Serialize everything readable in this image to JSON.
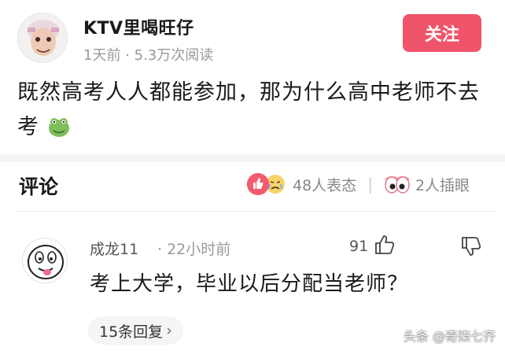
{
  "post": {
    "author": "KTV里喝旺仔",
    "meta": "1天前 · 5.3万次阅读",
    "follow_label": "关注",
    "text": "既然高考人人都能参加，那为什么高中老师不去考"
  },
  "comments_bar": {
    "title": "评论",
    "reactions_text": "48人表态",
    "insert_eye_text": "2人插眼"
  },
  "comment": {
    "user": "成龙11",
    "time": "· 22小时前",
    "likes": "91",
    "text": "考上大学，毕业以后分配当老师？",
    "replies_label": "15条回复"
  },
  "watermark": "头条 @奇柒七齐",
  "colors": {
    "follow_button": "#f0546a",
    "like_reaction": "#f25b6f",
    "muted_text": "#999999"
  }
}
